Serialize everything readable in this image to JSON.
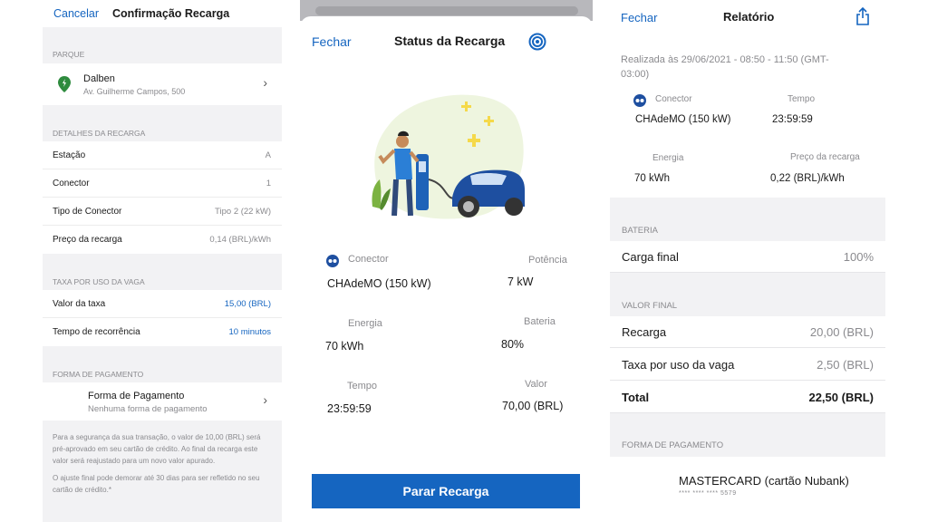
{
  "confirm": {
    "cancel": "Cancelar",
    "title": "Confirmação Recarga",
    "park_section": "PARQUE",
    "park_name": "Dalben",
    "park_address": "Av. Guilherme Campos, 500",
    "details_section": "DETALHES DA RECARGA",
    "details": [
      {
        "label": "Estação",
        "value": "A"
      },
      {
        "label": "Conector",
        "value": "1"
      },
      {
        "label": "Tipo de Conector",
        "value": "Tipo 2 (22 kW)"
      },
      {
        "label": "Preço da recarga",
        "value": "0,14 (BRL)/kWh"
      }
    ],
    "fee_section": "TAXA POR USO DA VAGA",
    "fees": [
      {
        "label": "Valor da taxa",
        "value": "15,00 (BRL)"
      },
      {
        "label": "Tempo de recorrência",
        "value": "10 minutos"
      }
    ],
    "payment_section": "FORMA DE PAGAMENTO",
    "payment_title": "Forma de Pagamento",
    "payment_sub": "Nenhuma forma de pagamento",
    "note1": "Para a segurança da sua transação, o valor de 10,00 (BRL) será pré-aprovado em seu cartão de crédito. Ao final da recarga este valor será reajustado para um novo valor apurado.",
    "note2": "O ajuste final pode demorar até 30 dias para ser refletido no seu cartão de crédito.*"
  },
  "status": {
    "close": "Fechar",
    "title": "Status da Recarga",
    "connector_label": "Conector",
    "connector_value": "CHAdeMO (150 kW)",
    "power_label": "Potência",
    "power_value": "7 kW",
    "energy_label": "Energia",
    "energy_value": "70 kWh",
    "battery_label": "Bateria",
    "battery_value": "80%",
    "time_label": "Tempo",
    "time_value": "23:59:59",
    "price_label": "Valor",
    "price_value": "70,00 (BRL)",
    "stop_button": "Parar Recarga"
  },
  "report": {
    "close": "Fechar",
    "title": "Relatório",
    "when": "Realizada às 29/06/2021 - 08:50 - 11:50 (GMT-03:00)",
    "connector_label": "Conector",
    "connector_value": "CHAdeMO (150 kW)",
    "time_label": "Tempo",
    "time_value": "23:59:59",
    "energy_label": "Energia",
    "energy_value": "70 kWh",
    "price_label": "Preço da recarga",
    "price_value": "0,22 (BRL)/kWh",
    "battery_section": "BATERIA",
    "final_charge_label": "Carga final",
    "final_charge_value": "100%",
    "final_section": "VALOR FINAL",
    "recharge_label": "Recarga",
    "recharge_value": "20,00 (BRL)",
    "fee_label": "Taxa por uso da vaga",
    "fee_value": "2,50 (BRL)",
    "total_label": "Total",
    "total_value": "22,50 (BRL)",
    "payment_section": "FORMA DE PAGAMENTO",
    "card_name": "MASTERCARD (cartão Nubank)",
    "card_number": "**** **** **** 5579"
  },
  "colors": {
    "accent": "#1565c0",
    "background_grey": "#f2f2f4",
    "park_pin": "#2e8b3e"
  },
  "icons": [
    "location-pin-icon",
    "chevron-right-icon",
    "target-icon",
    "connector-icon",
    "share-icon"
  ]
}
